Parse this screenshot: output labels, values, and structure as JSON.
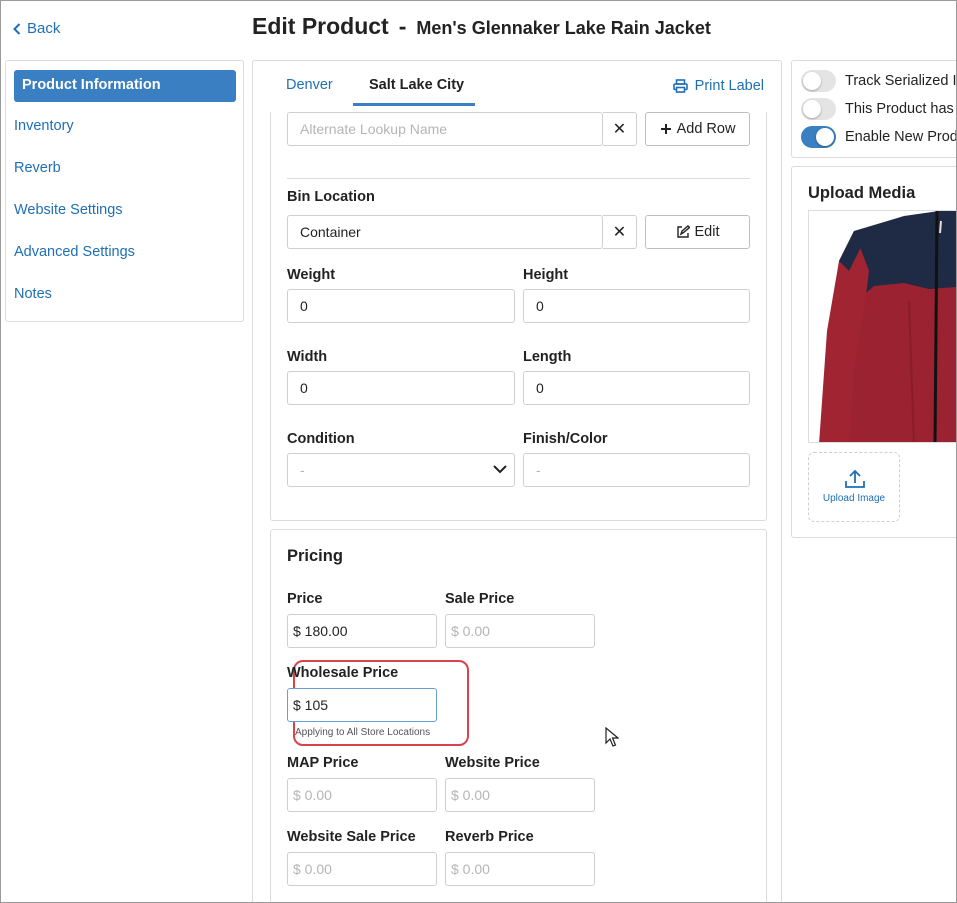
{
  "header": {
    "back_label": "Back",
    "title": "Edit Product",
    "separator": "-",
    "product_name": "Men's Glennaker Lake Rain Jacket"
  },
  "sidebar": {
    "items": [
      {
        "label": "Product Information",
        "active": true
      },
      {
        "label": "Inventory"
      },
      {
        "label": "Reverb"
      },
      {
        "label": "Website Settings"
      },
      {
        "label": "Advanced Settings"
      },
      {
        "label": "Notes"
      }
    ]
  },
  "tabs": [
    {
      "label": "Denver"
    },
    {
      "label": "Salt Lake City",
      "active": true
    }
  ],
  "print_label": "Print Label",
  "details": {
    "alternate_lookup": {
      "placeholder": "Alternate Lookup Name",
      "value": ""
    },
    "add_row_label": "Add Row",
    "bin_location": {
      "label": "Bin Location",
      "value": "Container"
    },
    "edit_label": "Edit",
    "weight": {
      "label": "Weight",
      "value": "0"
    },
    "height": {
      "label": "Height",
      "value": "0"
    },
    "width": {
      "label": "Width",
      "value": "0"
    },
    "length": {
      "label": "Length",
      "value": "0"
    },
    "condition": {
      "label": "Condition",
      "value": "-"
    },
    "finish_color": {
      "label": "Finish/Color",
      "value": "-"
    },
    "clear_glyph": "✕"
  },
  "pricing": {
    "title": "Pricing",
    "price": {
      "label": "Price",
      "value": "$ 180.00"
    },
    "sale_price": {
      "label": "Sale Price",
      "placeholder": "$ 0.00"
    },
    "wholesale_price": {
      "label": "Wholesale Price",
      "value": "$ 105",
      "hint": "Applying to All Store Locations"
    },
    "map_price": {
      "label": "MAP Price",
      "placeholder": "$ 0.00"
    },
    "website_price": {
      "label": "Website Price",
      "placeholder": "$ 0.00"
    },
    "website_sale_price": {
      "label": "Website Sale Price",
      "placeholder": "$ 0.00"
    },
    "reverb_price": {
      "label": "Reverb Price",
      "placeholder": "$ 0.00"
    }
  },
  "settings": {
    "toggles": [
      {
        "label": "Track Serialized In",
        "on": false
      },
      {
        "label": "This Product has",
        "on": false
      },
      {
        "label": "Enable New Produ",
        "on": true
      }
    ]
  },
  "media": {
    "title": "Upload Media",
    "upload_label": "Upload Image"
  },
  "colors": {
    "accent": "#3a7fc1",
    "link": "#1f6fb5",
    "highlight": "#d9434b"
  }
}
